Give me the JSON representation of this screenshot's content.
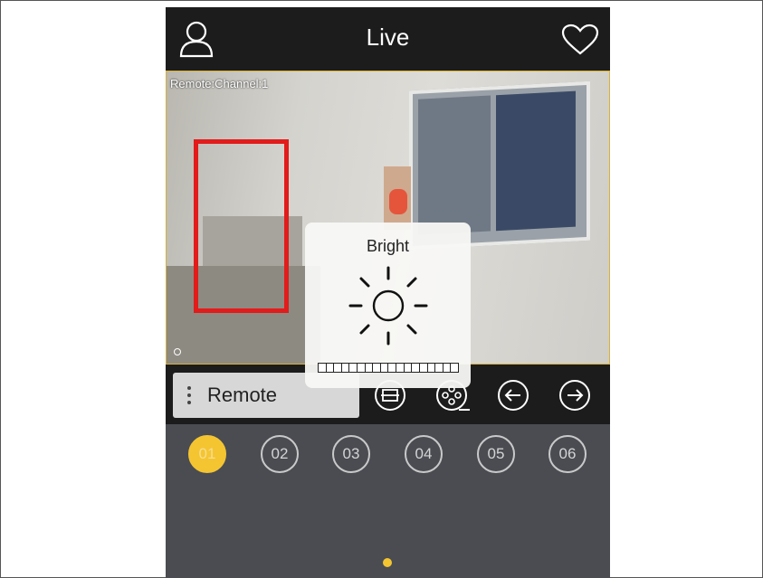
{
  "header": {
    "title": "Live",
    "left_icon": "user-icon",
    "right_icon": "heart-icon"
  },
  "video": {
    "osd_text": "Remote:Channel:1",
    "border_color": "#d9b235"
  },
  "brightness_panel": {
    "label": "Bright",
    "icon": "sun-icon",
    "level_segments": 18
  },
  "controls": {
    "remote_label": "Remote",
    "icons": [
      "fullscreen-icon",
      "film-reel-icon",
      "arrow-left-icon",
      "arrow-right-icon"
    ]
  },
  "channels": [
    "01",
    "02",
    "03",
    "04",
    "05",
    "06"
  ],
  "active_channel": "01",
  "colors": {
    "accent": "#f4c531",
    "highlight_box": "#e21b1b",
    "bar_bg": "#1c1c1c",
    "panel_bg": "#4a4c52"
  }
}
